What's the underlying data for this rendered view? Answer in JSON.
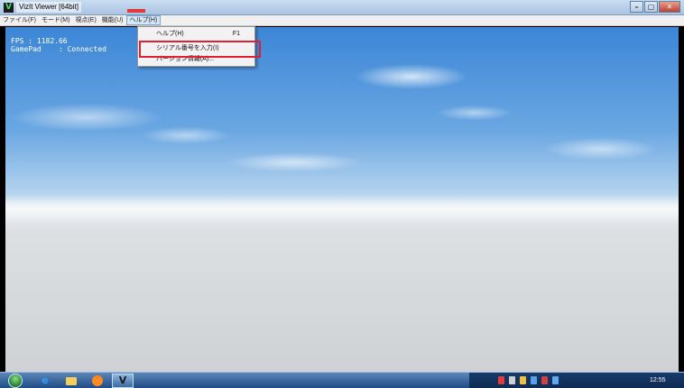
{
  "window": {
    "app_icon_glyph": "V",
    "title": "VizIt Viewer [64bit]",
    "controls": {
      "minimize": "–",
      "maximize": "▢",
      "close": "✕"
    }
  },
  "menubar": {
    "items": [
      {
        "label": "ファイル(F)"
      },
      {
        "label": "モード(M)"
      },
      {
        "label": "視点(E)"
      },
      {
        "label": "機能(U)"
      },
      {
        "label": "ヘルプ(H)",
        "active": true
      }
    ]
  },
  "help_menu": {
    "items": [
      {
        "label": "ヘルプ(H)",
        "shortcut": "F1"
      },
      {
        "label": "シリアル番号を入力(I)",
        "highlighted": true
      },
      {
        "label": "バージョン情報(A)..."
      }
    ]
  },
  "overlay": {
    "fps_line": "FPS : 1182.66",
    "gamepad_line": "GamePad    : Connected"
  },
  "taskbar": {
    "icons": [
      "start-orb",
      "ie-icon",
      "folder-icon",
      "media-player-icon",
      "vizit-icon"
    ],
    "vizit_glyph": "V",
    "ie_glyph": "e",
    "tray_colors": [
      "#e23b3b",
      "#cfcfcf",
      "#f0c040",
      "#5aa0e8",
      "#d04040",
      "#60a8f0"
    ],
    "clock": "12:55"
  },
  "colors": {
    "highlight_border": "#e02030",
    "sky_top": "#3c86d6",
    "ground": "#cfd2d5"
  }
}
